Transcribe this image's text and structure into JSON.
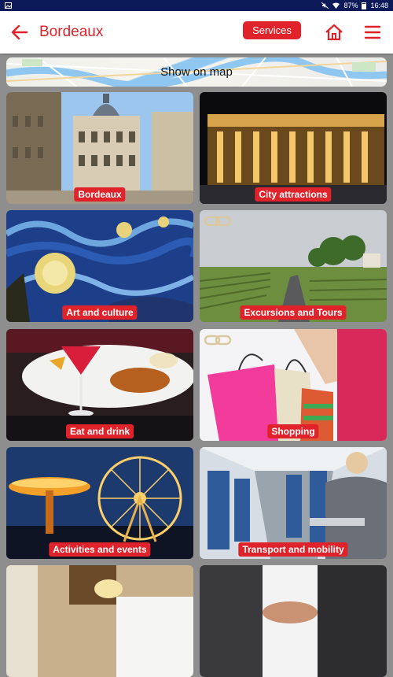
{
  "status_bar": {
    "battery": "87%",
    "time": "16:48"
  },
  "header": {
    "title": "Bordeaux",
    "services_label": "Services",
    "icons": [
      "back-arrow-icon",
      "home-icon",
      "hamburger-menu-icon"
    ]
  },
  "map": {
    "label": "Show on map"
  },
  "tiles": [
    {
      "label": "Bordeaux"
    },
    {
      "label": "City attractions"
    },
    {
      "label": "Art and culture"
    },
    {
      "label": "Excursions and Tours",
      "linked": true
    },
    {
      "label": "Eat and drink"
    },
    {
      "label": "Shopping",
      "linked": true
    },
    {
      "label": "Activities and events"
    },
    {
      "label": "Transport and mobility"
    },
    {
      "label": ""
    },
    {
      "label": ""
    }
  ],
  "colors": {
    "accent": "#e0232a",
    "status_bar": "#0d1a5a",
    "background": "#8e8e8e"
  }
}
